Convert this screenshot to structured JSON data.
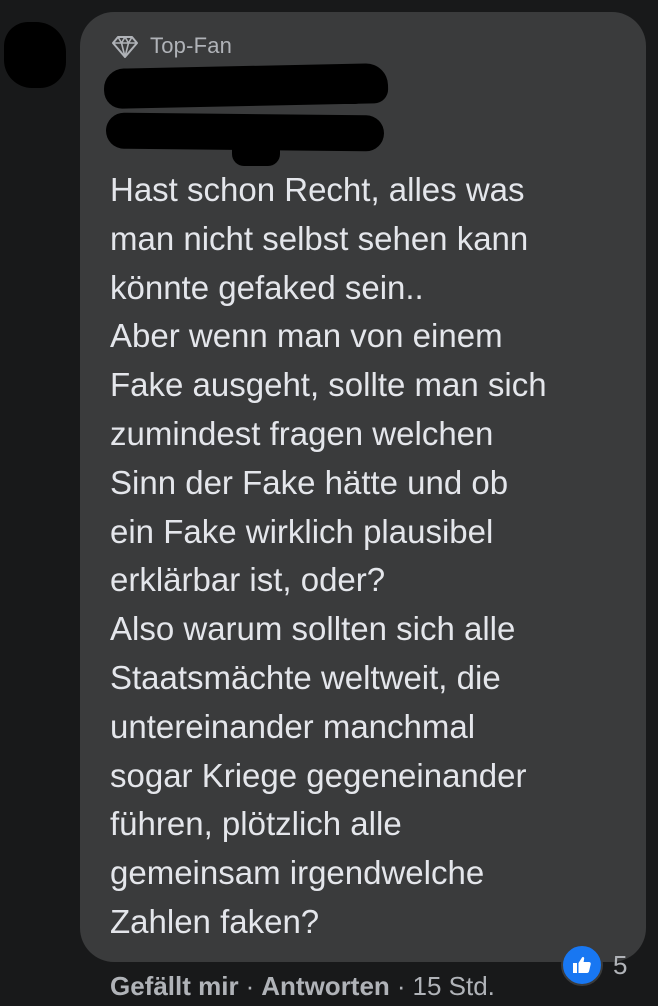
{
  "comment": {
    "badge": {
      "icon": "diamond-icon",
      "label": "Top-Fan"
    },
    "text": "Hast schon Recht, alles was\nman nicht selbst sehen kann\nkönnte gefaked sein..\nAber wenn man von einem\nFake ausgeht, sollte man sich\nzumindest fragen welchen\nSinn der Fake hätte und ob\nein Fake wirklich plausibel\nerklärbar ist, oder?\nAlso warum sollten sich alle\nStaatsmächte weltweit, die\nuntereinander manchmal\nsogar Kriege gegeneinander\nführen, plötzlich alle\ngemeinsam irgendwelche\nZahlen faken?"
  },
  "actions": {
    "like_label": "Gefällt mir",
    "separator": "·",
    "reply_label": "Antworten",
    "timestamp": "15 Std."
  },
  "reactions": {
    "icon": "thumbs-up-icon",
    "count": "5"
  },
  "colors": {
    "background": "#18191a",
    "bubble": "#3a3b3c",
    "text": "#e4e6eb",
    "muted": "#b0b3b8",
    "like_blue": "#1877f2"
  }
}
